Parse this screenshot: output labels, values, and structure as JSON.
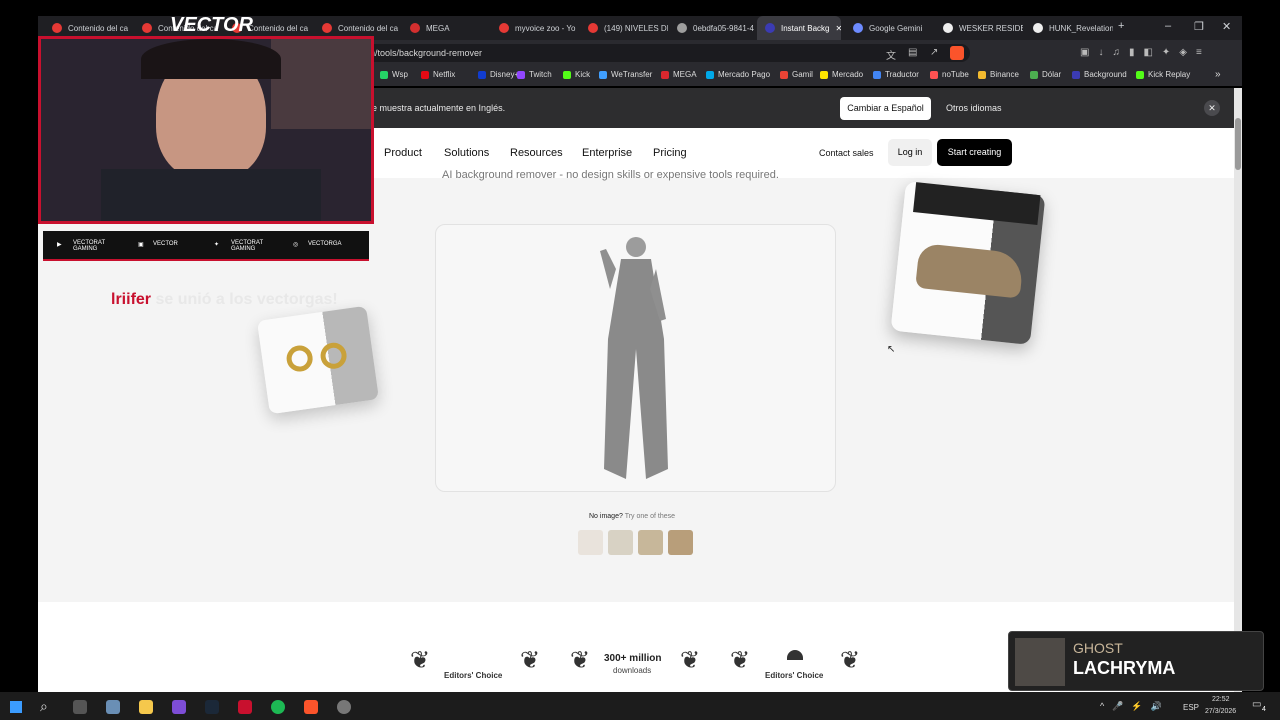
{
  "tabs": [
    {
      "label": "Contenido del ca",
      "color": "#e53935"
    },
    {
      "label": "Contenido del ca",
      "color": "#e53935"
    },
    {
      "label": "Contenido del ca",
      "color": "#e53935"
    },
    {
      "label": "Contenido del ca",
      "color": "#e53935"
    },
    {
      "label": "MEGA",
      "color": "#d32f2f"
    },
    {
      "label": "myvoice zoo - Yo",
      "color": "#e53935"
    },
    {
      "label": "(149) NIVELES DE",
      "color": "#e53935"
    },
    {
      "label": "0ebdfa05-9841-4",
      "color": "#9e9e9e"
    },
    {
      "label": "Instant Backg",
      "color": "#3b3bb3"
    },
    {
      "label": "Google Gemini",
      "color": "#6d8bff"
    },
    {
      "label": "WESKER RESIDEN",
      "color": "#eeeeee"
    },
    {
      "label": "HUNK_Revelation",
      "color": "#eeeeee"
    }
  ],
  "url": "n/tools/background-remover",
  "bookmarks": [
    {
      "label": "Wsp",
      "color": "#25d366"
    },
    {
      "label": "Netflix",
      "color": "#e50914"
    },
    {
      "label": "Disney+",
      "color": "#113ccf"
    },
    {
      "label": "Twitch",
      "color": "#9146ff"
    },
    {
      "label": "Kick",
      "color": "#53fc18"
    },
    {
      "label": "WeTransfer",
      "color": "#409fff"
    },
    {
      "label": "MEGA",
      "color": "#d9272e"
    },
    {
      "label": "Mercado Pago",
      "color": "#00a8e8"
    },
    {
      "label": "Gamil",
      "color": "#ea4335"
    },
    {
      "label": "Mercado",
      "color": "#ffe600"
    },
    {
      "label": "Traductor",
      "color": "#4285f4"
    },
    {
      "label": "noTube",
      "color": "#ff5252"
    },
    {
      "label": "Binance",
      "color": "#f3ba2f"
    },
    {
      "label": "Dólar",
      "color": "#4caf50"
    },
    {
      "label": "Background",
      "color": "#3b3bb3"
    },
    {
      "label": "Kick Replay",
      "color": "#53fc18"
    }
  ],
  "translate_bar": {
    "text": "e muestra actualmente en Inglés.",
    "switch_button": "Cambiar a Español",
    "other_languages": "Otros idiomas"
  },
  "nav": {
    "links": [
      "Product",
      "Solutions",
      "Resources",
      "Enterprise",
      "Pricing"
    ],
    "contact": "Contact sales",
    "login": "Log in",
    "cta": "Start creating"
  },
  "hero": {
    "subtitle": "AI background remover - no design skills or expensive tools required.",
    "no_image": "No image?",
    "try_these": "Try one of these"
  },
  "awards": {
    "apple": "Editors' Choice",
    "downloads_big": "300+ million",
    "downloads_small": "downloads",
    "android": "Editors' Choice"
  },
  "stream_overlay": {
    "logo": "VECTOR",
    "socials": [
      "VECTORAT GAMING",
      "VECTOR",
      "VECTORAT GAMING",
      "VECTORGA"
    ],
    "alert_user": "lriifer",
    "alert_text": "se unió a los vectorgas!",
    "song_artist": "GHOST",
    "song_title": "LACHRYMA"
  },
  "taskbar": {
    "lang": "ESP",
    "time": "22:52",
    "date": "27/3/2026",
    "notif_count": "4"
  }
}
